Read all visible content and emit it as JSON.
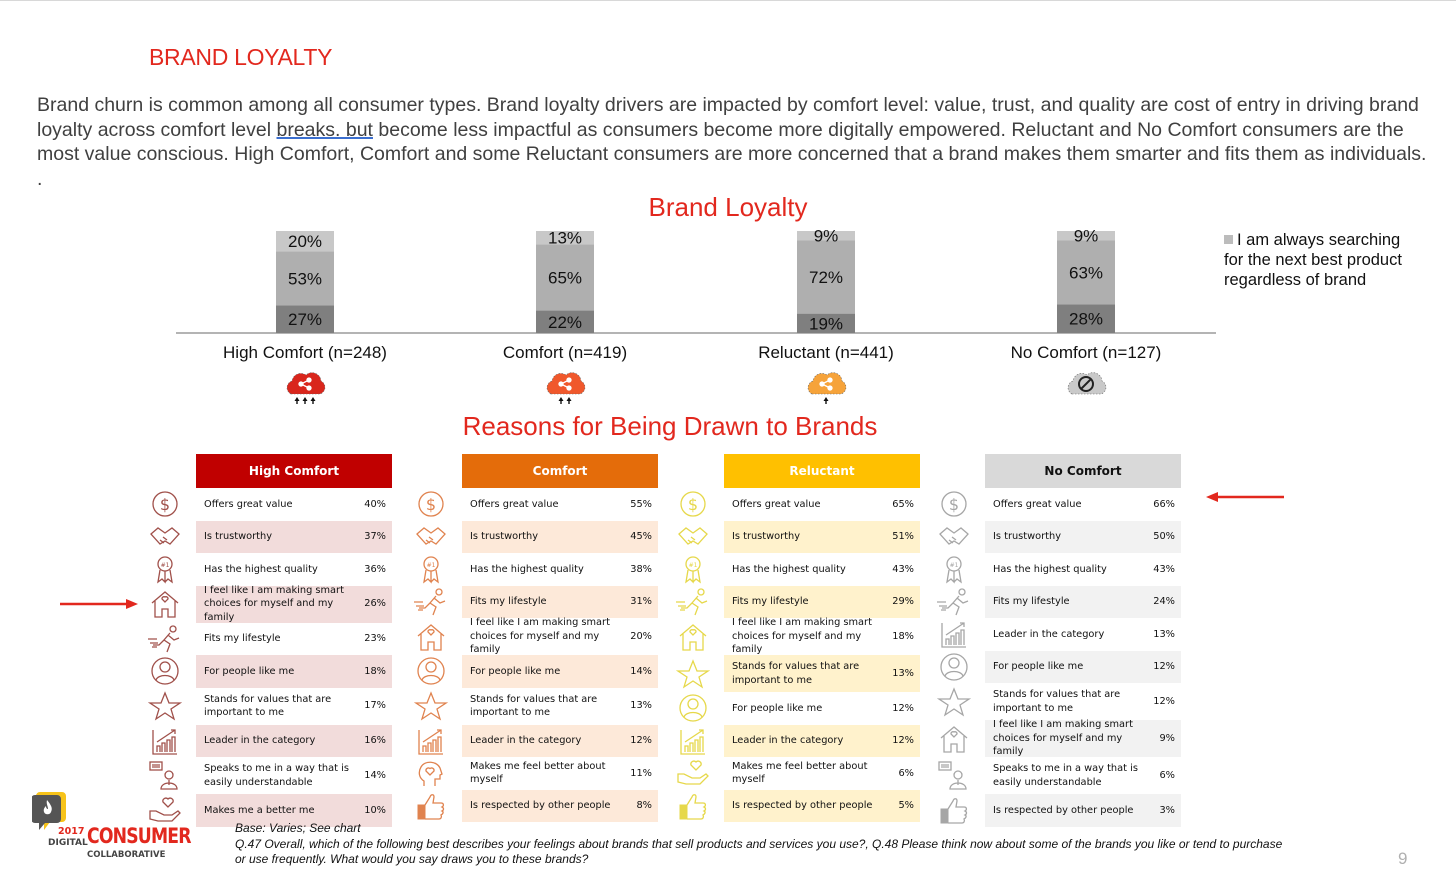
{
  "page": {
    "title": "BRAND LOYALTY",
    "intro_parts": [
      "Brand churn is common among all consumer types. Brand loyalty drivers are impacted by comfort level: value, trust, and quality are cost of entry in driving brand loyalty across comfort level ",
      "breaks. but",
      " become less impactful as consumers become more digitally empowered. Reluctant and No Comfort consumers are the most value conscious. High Comfort, Comfort and some Reluctant consumers are more concerned that a brand makes them smarter and fits them as individuals. ."
    ],
    "page_number": "9"
  },
  "chart_data": {
    "type": "bar",
    "stacked": true,
    "title": "Brand Loyalty",
    "categories": [
      "High Comfort (n=248)",
      "Comfort (n=419)",
      "Reluctant (n=441)",
      "No Comfort (n=127)"
    ],
    "series": [
      {
        "name": "bottom segment (dark gray)",
        "color": "#7f7f7f",
        "values": [
          27,
          22,
          19,
          28
        ]
      },
      {
        "name": "middle segment (gray)",
        "color": "#afafaf",
        "values": [
          53,
          65,
          72,
          63
        ]
      },
      {
        "name": "I am always searching for the next best product regardless of brand",
        "color": "#c8c8c8",
        "values": [
          20,
          13,
          9,
          9
        ]
      }
    ],
    "value_suffix": "%",
    "ylim": [
      0,
      100
    ],
    "legend": {
      "position": "right",
      "entries": [
        "I am always searching for the next best product regardless of brand"
      ]
    },
    "grid": false
  },
  "segments": [
    {
      "name": "High Comfort",
      "cloud_color": "#d9261c",
      "arrows": 3,
      "icon": "share-icon"
    },
    {
      "name": "Comfort",
      "cloud_color": "#f0582c",
      "arrows": 2,
      "icon": "share-icon"
    },
    {
      "name": "Reluctant",
      "cloud_color": "#f6a33a",
      "arrows": 1,
      "icon": "share-icon"
    },
    {
      "name": "No Comfort",
      "cloud_color": "#c9c9c9",
      "arrows": 0,
      "icon": "prohibited-icon"
    }
  ],
  "reasons": {
    "title": "Reasons for Being Drawn to Brands",
    "tables": [
      {
        "header": "High Comfort",
        "header_color": "#c00000",
        "header_text_color": "#ffffff",
        "stripe_color": "#f2dcdb",
        "icon_color": "#a0504a",
        "rows": [
          {
            "icon": "dollar-icon",
            "label": "Offers great value",
            "value": "40%"
          },
          {
            "icon": "handshake-icon",
            "label": "Is trustworthy",
            "value": "37%"
          },
          {
            "icon": "award-ribbon-icon",
            "label": "Has the highest quality",
            "value": "36%"
          },
          {
            "icon": "house-heart-icon",
            "label": "I feel like I am making smart choices for myself and my family",
            "value": "26%"
          },
          {
            "icon": "runner-icon",
            "label": "Fits my lifestyle",
            "value": "23%"
          },
          {
            "icon": "person-circle-icon",
            "label": "For people like me",
            "value": "18%"
          },
          {
            "icon": "star-icon",
            "label": "Stands for values that are important to me",
            "value": "17%"
          },
          {
            "icon": "growth-chart-icon",
            "label": "Leader in the category",
            "value": "16%"
          },
          {
            "icon": "speech-person-icon",
            "label": "Speaks to me in a way that is easily understandable",
            "value": "14%"
          },
          {
            "icon": "heart-hand-icon",
            "label": "Makes me a better me",
            "value": "10%"
          }
        ]
      },
      {
        "header": "Comfort",
        "header_color": "#e46c0a",
        "header_text_color": "#ffffff",
        "stripe_color": "#fde9d9",
        "icon_color": "#e0834f",
        "rows": [
          {
            "icon": "dollar-icon",
            "label": "Offers great value",
            "value": "55%"
          },
          {
            "icon": "handshake-icon",
            "label": "Is trustworthy",
            "value": "45%"
          },
          {
            "icon": "award-ribbon-icon",
            "label": "Has the highest quality",
            "value": "38%"
          },
          {
            "icon": "runner-icon",
            "label": "Fits my lifestyle",
            "value": "31%"
          },
          {
            "icon": "house-heart-icon",
            "label": "I feel like I am making smart choices for myself and my family",
            "value": "20%"
          },
          {
            "icon": "person-circle-icon",
            "label": "For people like me",
            "value": "14%"
          },
          {
            "icon": "star-icon",
            "label": "Stands for values that are important to me",
            "value": "13%"
          },
          {
            "icon": "growth-chart-icon",
            "label": "Leader in the category",
            "value": "12%"
          },
          {
            "icon": "head-heart-icon",
            "label": "Makes me feel better about myself",
            "value": "11%"
          },
          {
            "icon": "thumbs-up-icon",
            "label": "Is respected by other people",
            "value": "8%"
          }
        ]
      },
      {
        "header": "Reluctant",
        "header_color": "#ffc000",
        "header_text_color": "#ffffff",
        "stripe_color": "#fff2cc",
        "icon_color": "#e6d84a",
        "rows": [
          {
            "icon": "dollar-icon",
            "label": "Offers great value",
            "value": "65%"
          },
          {
            "icon": "handshake-icon",
            "label": "Is trustworthy",
            "value": "51%"
          },
          {
            "icon": "award-ribbon-icon",
            "label": "Has the highest quality",
            "value": "43%"
          },
          {
            "icon": "runner-icon",
            "label": "Fits my lifestyle",
            "value": "29%"
          },
          {
            "icon": "house-heart-icon",
            "label": "I feel like I am making smart choices for myself and my family",
            "value": "18%"
          },
          {
            "icon": "star-icon",
            "label": "Stands for values that are important to me",
            "value": "13%"
          },
          {
            "icon": "person-circle-icon",
            "label": "For people like me",
            "value": "12%"
          },
          {
            "icon": "growth-chart-icon",
            "label": "Leader in the category",
            "value": "12%"
          },
          {
            "icon": "heart-hand-icon",
            "label": "Makes me feel better about myself",
            "value": "6%"
          },
          {
            "icon": "thumbs-up-icon",
            "label": "Is respected by other people",
            "value": "5%"
          }
        ]
      },
      {
        "header": "No Comfort",
        "header_color": "#d9d9d9",
        "header_text_color": "#111111",
        "stripe_color": "#f2f2f2",
        "icon_color": "#a6a6a6",
        "rows": [
          {
            "icon": "dollar-icon",
            "label": "Offers great value",
            "value": "66%"
          },
          {
            "icon": "handshake-icon",
            "label": "Is trustworthy",
            "value": "50%"
          },
          {
            "icon": "award-ribbon-icon",
            "label": "Has the highest quality",
            "value": "43%"
          },
          {
            "icon": "runner-icon",
            "label": "Fits my lifestyle",
            "value": "24%"
          },
          {
            "icon": "growth-chart-icon",
            "label": "Leader in the category",
            "value": "13%"
          },
          {
            "icon": "person-circle-icon",
            "label": "For people like me",
            "value": "12%"
          },
          {
            "icon": "star-icon",
            "label": "Stands for values that are important to me",
            "value": "12%"
          },
          {
            "icon": "house-heart-icon",
            "label": "I feel like I am making smart choices for myself and my family",
            "value": "9%"
          },
          {
            "icon": "speech-person-icon",
            "label": "Speaks to me in a way that is easily understandable",
            "value": "6%"
          },
          {
            "icon": "thumbs-up-icon",
            "label": "Is respected by other people",
            "value": "3%"
          }
        ]
      }
    ]
  },
  "annotations": {
    "arrow_color": "#e2281e"
  },
  "logo": {
    "year": "2017",
    "line1": "DIGITAL",
    "brand": "CONSUMER",
    "line2": "COLLABORATIVE",
    "brand_color": "#e2281e"
  },
  "footer": {
    "base": "Base: Varies; See chart",
    "question": "Q.47 Overall, which of the following best describes your feelings about brands that sell products and services you use?, Q.48   Please think now about some of the brands you like or tend to purchase or use frequently. What would you say draws you to these brands?"
  }
}
